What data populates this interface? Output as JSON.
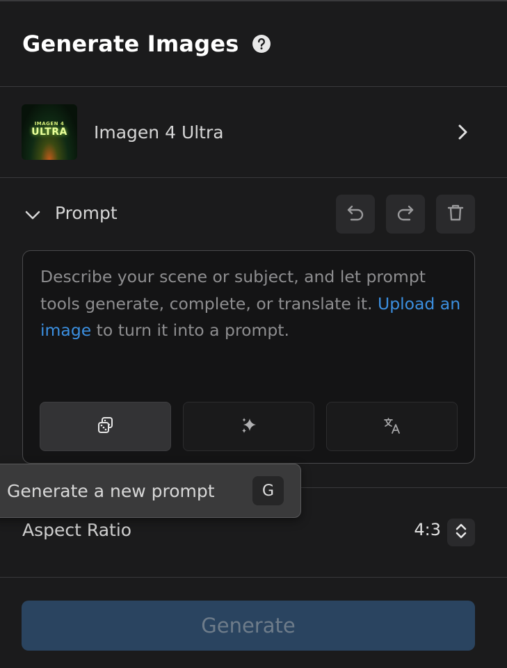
{
  "header": {
    "title": "Generate Images",
    "help_icon": "question-circle-icon"
  },
  "model": {
    "name": "Imagen 4 Ultra",
    "thumb_line1": "IMAGEN 4",
    "thumb_line2": "ULTRA",
    "icon": "chevron-right-icon"
  },
  "prompt": {
    "label": "Prompt",
    "placeholder_part1": "Describe your scene or subject, and let prompt tools generate, complete, or translate it. ",
    "placeholder_link": "Upload an image",
    "placeholder_part2": " to turn it into a prompt.",
    "tools": [
      "undo-icon",
      "redo-icon",
      "trash-icon"
    ],
    "buttons": [
      "dice-icon",
      "sparkle-icon",
      "translate-icon"
    ]
  },
  "tooltip": {
    "text": "Generate a new prompt",
    "shortcut": "G"
  },
  "aspect": {
    "label": "Aspect Ratio",
    "value": "4:3"
  },
  "generate": {
    "label": "Generate"
  },
  "colors": {
    "accent": "#3b8fe0",
    "generate_bg": "#2a4460",
    "bg": "#1b1b1c"
  }
}
